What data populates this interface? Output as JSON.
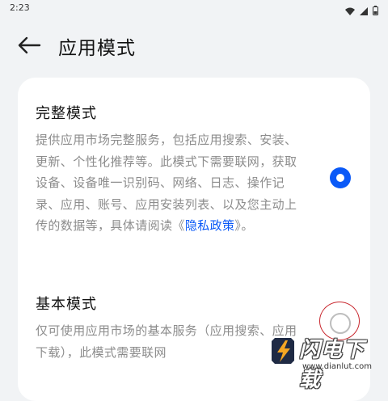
{
  "status_bar": {
    "time": "2:23"
  },
  "header": {
    "title": "应用模式"
  },
  "options": [
    {
      "title": "完整模式",
      "desc_before_link": "提供应用市场完整服务，包括应用搜索、安装、更新、个性化推荐等。此模式下需要联网，获取设备、设备唯一识别码、网络、日志、操作记录、应用、账号、应用安装列表、以及您主动上传的数据等，具体请阅读《",
      "link": "隐私政策",
      "desc_after_link": "》。",
      "selected": true
    },
    {
      "title": "基本模式",
      "desc": "仅可使用应用市场的基本服务（应用搜索、应用下载），此模式需要联网",
      "selected": false
    }
  ],
  "colors": {
    "accent": "#0a59f7",
    "background": "#f1f3f5",
    "card": "#ffffff",
    "desc_text": "#8c8c8c"
  },
  "watermark": {
    "name": "闪电下载",
    "url": "www.dianlut.com"
  }
}
